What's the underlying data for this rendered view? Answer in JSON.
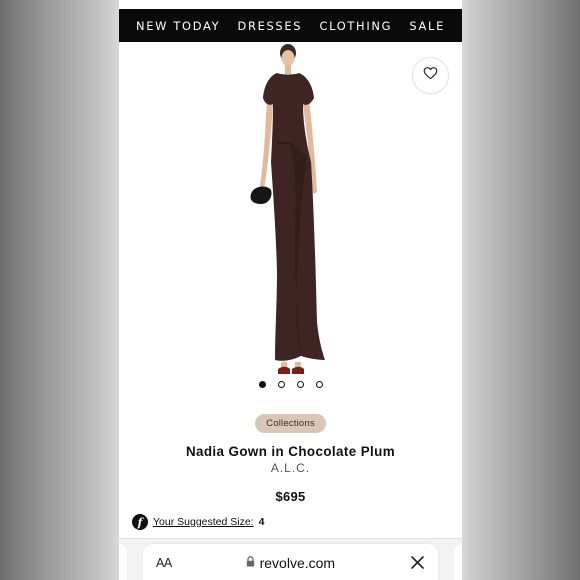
{
  "nav": {
    "items": [
      "NEW TODAY",
      "DRESSES",
      "CLOTHING",
      "SALE"
    ]
  },
  "gallery": {
    "image_count": 4,
    "active_index": 0,
    "wishlist_icon": "heart-icon"
  },
  "product": {
    "badge": "Collections",
    "name": "Nadia Gown in Chocolate Plum",
    "brand": "A.L.C.",
    "price": "$695"
  },
  "fit": {
    "logo_letter": "f",
    "label": "Your Suggested Size:",
    "value": "4"
  },
  "browser": {
    "text_size_label": "AA",
    "url": "revolve.com",
    "lock_icon": "lock-icon",
    "close_icon": "close-icon"
  },
  "colors": {
    "nav_bg": "#0a0a0a",
    "dress": "#3e2524",
    "badge_bg": "#d9c6b7"
  }
}
